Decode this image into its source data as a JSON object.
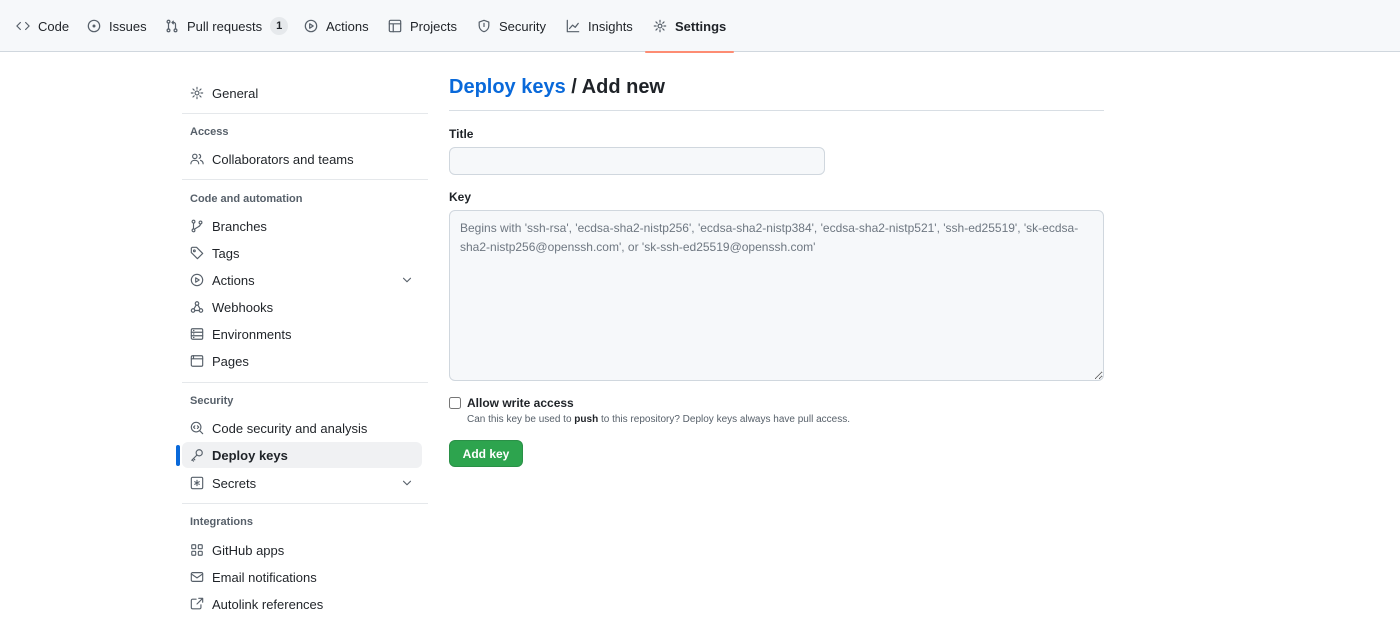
{
  "nav": {
    "tabs": [
      {
        "label": "Code",
        "icon": "code-icon"
      },
      {
        "label": "Issues",
        "icon": "issue-icon"
      },
      {
        "label": "Pull requests",
        "icon": "pull-request-icon",
        "count": "1"
      },
      {
        "label": "Actions",
        "icon": "play-icon"
      },
      {
        "label": "Projects",
        "icon": "table-icon"
      },
      {
        "label": "Security",
        "icon": "shield-icon"
      },
      {
        "label": "Insights",
        "icon": "graph-icon"
      },
      {
        "label": "Settings",
        "icon": "gear-icon",
        "active": true
      }
    ]
  },
  "sidebar": {
    "general": "General",
    "access_heading": "Access",
    "collaborators": "Collaborators and teams",
    "code_heading": "Code and automation",
    "branches": "Branches",
    "tags": "Tags",
    "actions": "Actions",
    "webhooks": "Webhooks",
    "environments": "Environments",
    "pages": "Pages",
    "security_heading": "Security",
    "code_security": "Code security and analysis",
    "deploy_keys": "Deploy keys",
    "secrets": "Secrets",
    "integrations_heading": "Integrations",
    "github_apps": "GitHub apps",
    "email_notifications": "Email notifications",
    "autolink_references": "Autolink references"
  },
  "main": {
    "breadcrumb_link": "Deploy keys",
    "breadcrumb_rest": " / Add new",
    "title_label": "Title",
    "title_value": "",
    "key_label": "Key",
    "key_placeholder": "Begins with 'ssh-rsa', 'ecdsa-sha2-nistp256', 'ecdsa-sha2-nistp384', 'ecdsa-sha2-nistp521', 'ssh-ed25519', 'sk-ecdsa-sha2-nistp256@openssh.com', or 'sk-ssh-ed25519@openssh.com'",
    "allow_write_label": "Allow write access",
    "allow_write_checked": false,
    "note_before": "Can this key be used to ",
    "note_bold": "push",
    "note_after": " to this repository? Deploy keys always have pull access.",
    "add_button": "Add key"
  },
  "colors": {
    "accent_link": "#0969da",
    "primary_button": "#2da44e",
    "active_tab_underline": "#fd8c73"
  }
}
